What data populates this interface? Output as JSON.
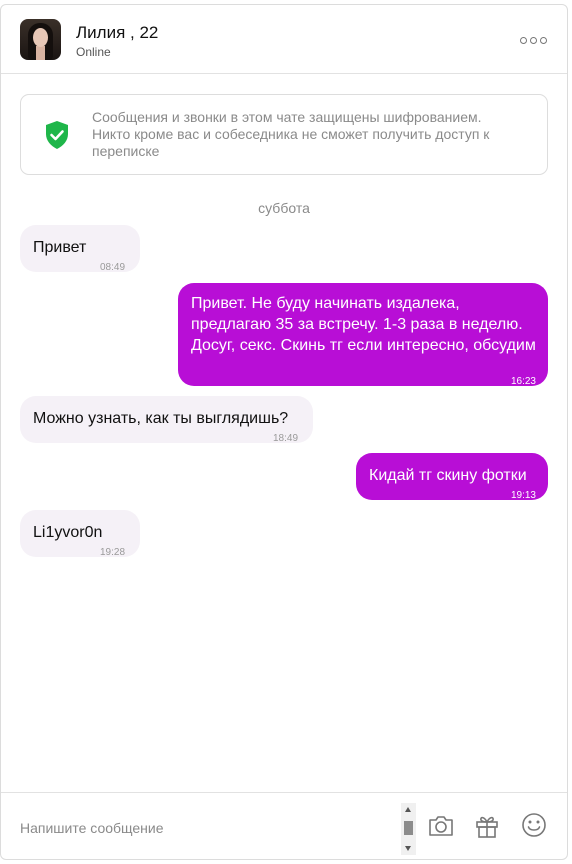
{
  "header": {
    "name": "Лилия , 22",
    "status": "Online"
  },
  "notice": {
    "text": "Сообщения и звонки в этом чате защищены шифрованием. Никто кроме вас и собеседника не сможет получить доступ к переписке"
  },
  "date_separator": "суббота",
  "messages": [
    {
      "direction": "incoming",
      "text": "Привет",
      "time": "08:49"
    },
    {
      "direction": "outgoing",
      "text": "Привет. Не буду начинать издалека, предлагаю 35 за встречу. 1-3 раза в неделю. Досуг, секс. Скинь тг если интересно, обсудим",
      "time": "16:23"
    },
    {
      "direction": "incoming",
      "text": "Можно узнать, как ты выглядишь?",
      "time": "18:49"
    },
    {
      "direction": "outgoing",
      "text": "Кидай тг скину фотки",
      "time": "19:13"
    },
    {
      "direction": "incoming",
      "text": "Li1yvor0n",
      "time": "19:28"
    }
  ],
  "composer": {
    "placeholder": "Напишите сообщение"
  },
  "colors": {
    "outgoing_bubble": "#b80ed6",
    "incoming_bubble": "#f5f1f7",
    "shield": "#1fb64a"
  },
  "icons": {
    "more": "more-dots-icon",
    "shield": "shield-check-icon",
    "camera": "camera-icon",
    "gift": "gift-icon",
    "emoji": "smiley-icon"
  }
}
